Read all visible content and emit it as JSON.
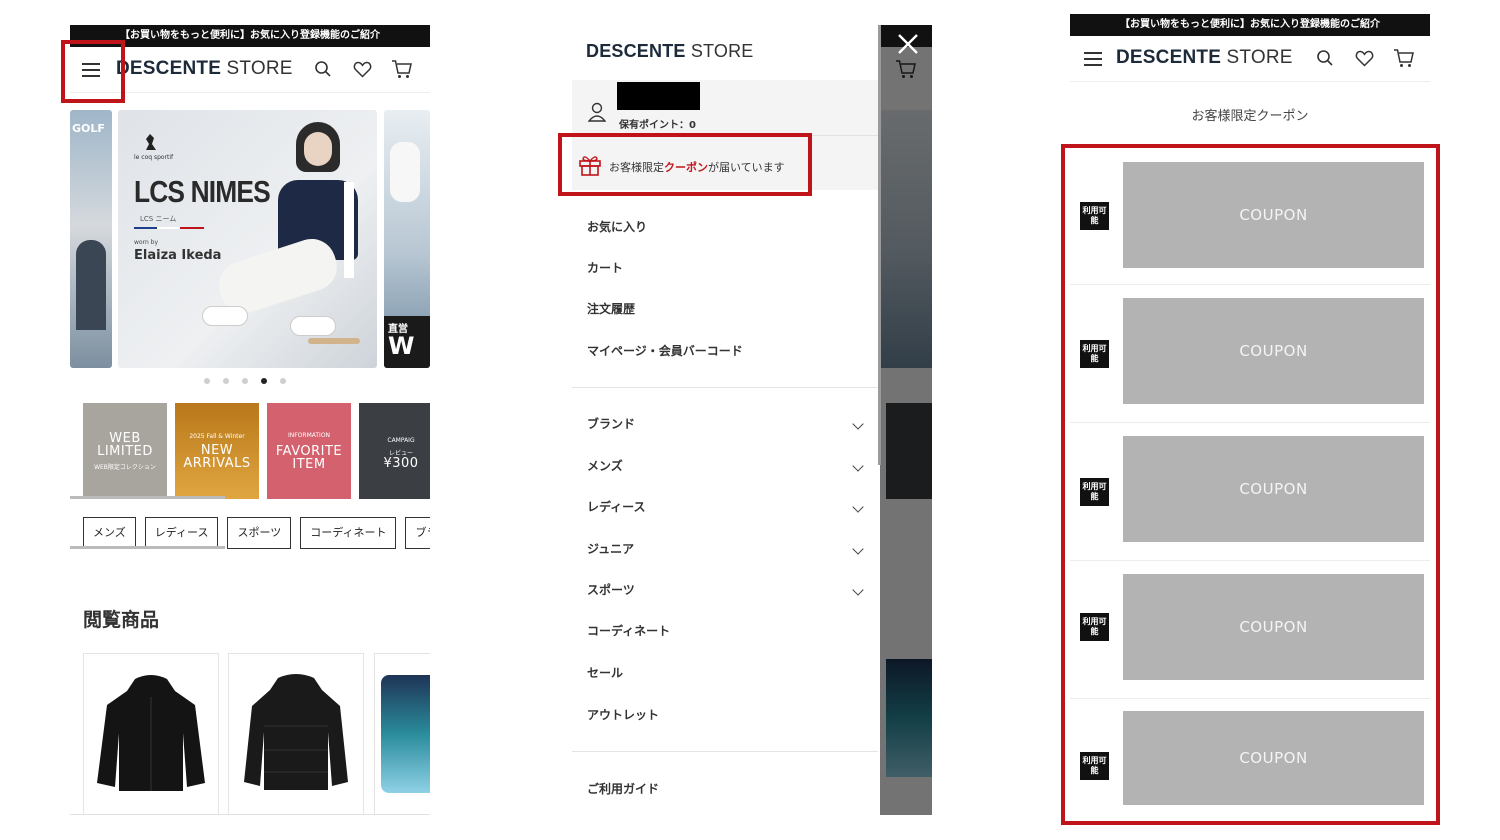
{
  "shared": {
    "announcement": "【お買い物をもっと便利に】お気に入り登録機能のご紹介",
    "logo_brand": "DESCENTE",
    "logo_store": "STORE"
  },
  "panel1": {
    "side_banner_label": "GOLF",
    "main_banner": {
      "brand": "le coq sportif",
      "title": "LCS NIMES",
      "subtitle": "LCS ニーム",
      "worn_by": "worn by",
      "model": "Elaiza Ikeda"
    },
    "right_banner_label": "直営",
    "right_banner_big": "W",
    "carousel": {
      "count": 5,
      "active_index": 3
    },
    "tiles": [
      {
        "line1": "WEB",
        "line2": "LIMITED",
        "sub": "WEB限定コレクション",
        "color": "#a8a49e"
      },
      {
        "line1": "NEW",
        "line2": "ARRIVALS",
        "sub": "2025 Fall & Winter",
        "color": "#d9962a"
      },
      {
        "line1": "FAVORITE",
        "line2": "ITEM",
        "sub": "INFORMATION",
        "color": "#d4626e"
      },
      {
        "line1": "CAMPAIG",
        "line2": "¥300",
        "sub": "レビュー",
        "color": "#3b3f44"
      }
    ],
    "chips": [
      "メンズ",
      "レディース",
      "スポーツ",
      "コーディネート",
      "ブラン"
    ],
    "recent_heading": "閲覧商品"
  },
  "panel2": {
    "points_label": "保有ポイント：0",
    "coupon_notice_before": "お客様限定",
    "coupon_notice_highlight": "クーポン",
    "coupon_notice_after": "が届いています",
    "links": [
      "お気に入り",
      "カート",
      "注文履歴",
      "マイページ・会員バーコード"
    ],
    "categories": [
      "ブランド",
      "メンズ",
      "レディース",
      "ジュニア",
      "スポーツ"
    ],
    "plain_categories": [
      "コーディネート",
      "セール",
      "アウトレット"
    ],
    "guide": "ご利用ガイド",
    "accent": "#c0141b"
  },
  "panel3": {
    "page_title": "お客様限定クーポン",
    "badge_text": "利用可能",
    "coupons": [
      "COUPON",
      "COUPON",
      "COUPON",
      "COUPON",
      "COUPON"
    ]
  },
  "colors": {
    "highlight_red": "#c0141b",
    "coupon_gray": "#b3b3b3",
    "header_black": "#111111"
  }
}
